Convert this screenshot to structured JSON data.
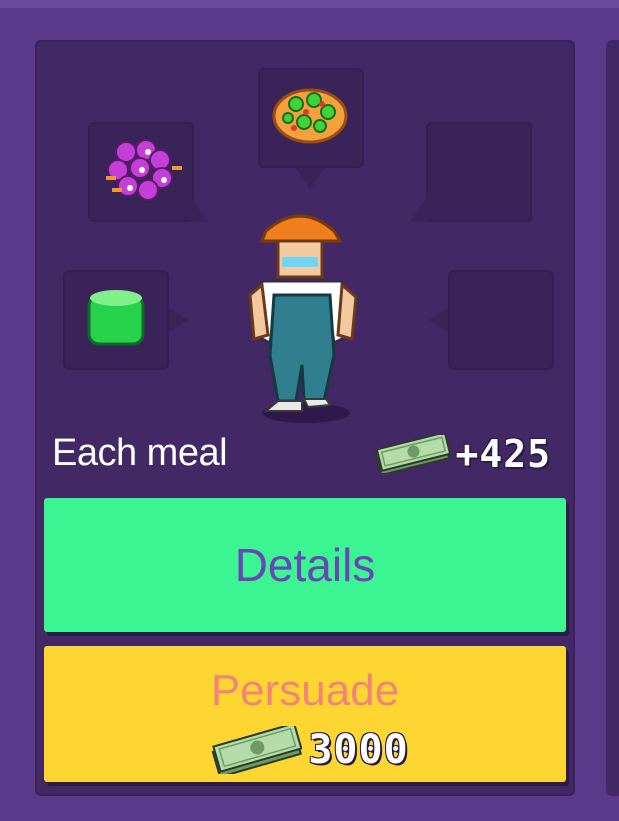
{
  "card": {
    "earnings_label": "Each meal",
    "earnings_value": "+425",
    "food_slots": [
      {
        "name": "purple-berries-icon",
        "filled": true
      },
      {
        "name": "pizza-icon",
        "filled": true
      },
      {
        "name": "empty-slot",
        "filled": false
      },
      {
        "name": "green-gem-icon",
        "filled": true
      },
      {
        "name": "empty-slot",
        "filled": false
      }
    ],
    "character": "construction-worker-sprite"
  },
  "buttons": {
    "details_label": "Details",
    "persuade_label": "Persuade",
    "persuade_cost": "3000"
  },
  "colors": {
    "background": "#5b3a8c",
    "card": "#422966",
    "details_button": "#3bf592",
    "persuade_button": "#fdd632",
    "details_text": "#6a45b8",
    "persuade_text": "#f3847a"
  }
}
